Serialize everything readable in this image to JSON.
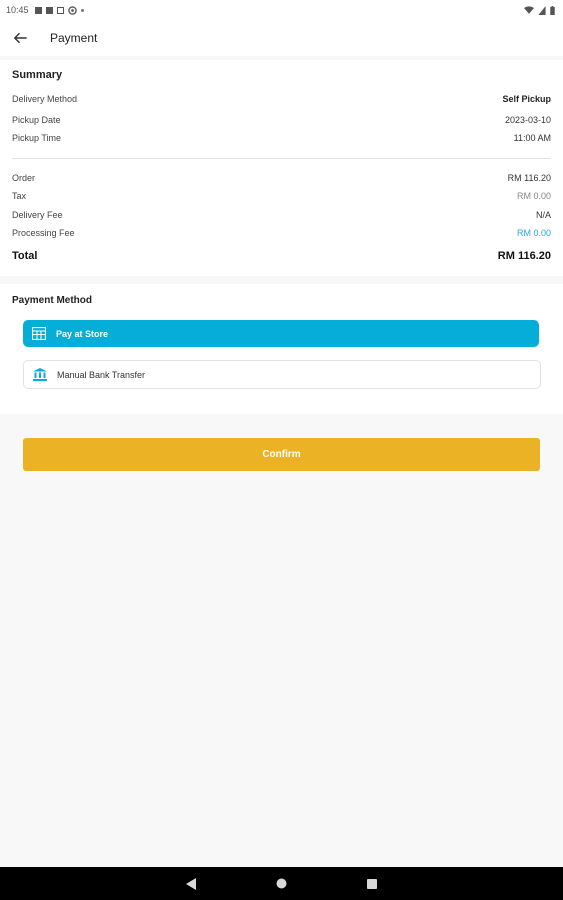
{
  "status_bar": {
    "time": "10:45"
  },
  "app_bar": {
    "title": "Payment"
  },
  "summary": {
    "title": "Summary",
    "rows": [
      {
        "label": "Delivery Method",
        "value": "Self Pickup"
      },
      {
        "label": "Pickup Date",
        "value": "2023-03-10"
      },
      {
        "label": "Pickup Time",
        "value": "11:00 AM"
      }
    ],
    "charges": [
      {
        "label": "Order",
        "value": "RM 116.20"
      },
      {
        "label": "Tax",
        "value": "RM 0.00"
      },
      {
        "label": "Delivery Fee",
        "value": "N/A"
      },
      {
        "label": "Processing Fee",
        "value": "RM 0.00"
      }
    ],
    "total": {
      "label": "Total",
      "value": "RM 116.20"
    }
  },
  "payment": {
    "title": "Payment Method",
    "options": [
      {
        "label": "Pay at Store",
        "icon": "store-icon",
        "selected": true
      },
      {
        "label": "Manual Bank Transfer",
        "icon": "bank-icon",
        "selected": false
      }
    ]
  },
  "confirm": {
    "label": "Confirm"
  },
  "colors": {
    "accent": "#05aed9",
    "confirm": "#ebb226",
    "link": "#29a7d6"
  }
}
